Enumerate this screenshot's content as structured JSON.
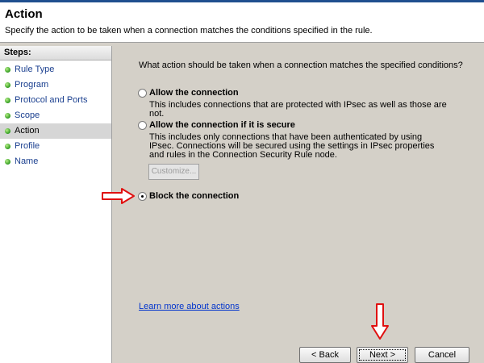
{
  "header": {
    "title": "Action",
    "subtitle": "Specify the action to be taken when a connection matches the conditions specified in the rule."
  },
  "steps": {
    "heading": "Steps:",
    "items": [
      {
        "label": "Rule Type",
        "active": false
      },
      {
        "label": "Program",
        "active": false
      },
      {
        "label": "Protocol and Ports",
        "active": false
      },
      {
        "label": "Scope",
        "active": false
      },
      {
        "label": "Action",
        "active": true
      },
      {
        "label": "Profile",
        "active": false
      },
      {
        "label": "Name",
        "active": false
      }
    ]
  },
  "main": {
    "question": "What action should be taken when a connection matches the specified conditions?",
    "options": [
      {
        "label": "Allow the connection",
        "description": "This includes connections that are protected with IPsec as well as those are not.",
        "selected": false
      },
      {
        "label": "Allow the connection if it is secure",
        "description": "This includes only connections that have been authenticated by using IPsec.  Connections will be secured using the settings in IPsec properties and rules in the Connection Security Rule node.",
        "selected": false
      },
      {
        "label": "Block the connection",
        "description": "",
        "selected": true
      }
    ],
    "customize_label": "Customize...",
    "learn_more": "Learn more about actions"
  },
  "buttons": {
    "back": "< Back",
    "next": "Next >",
    "cancel": "Cancel"
  },
  "colors": {
    "link": "#0033cc",
    "step_link": "#1a3f8f",
    "annotation": "#e01010",
    "title_band": "#1f4f8f"
  },
  "icons": {
    "step_bullet": "green-dot-icon",
    "annotation": "red-arrow-icon"
  }
}
